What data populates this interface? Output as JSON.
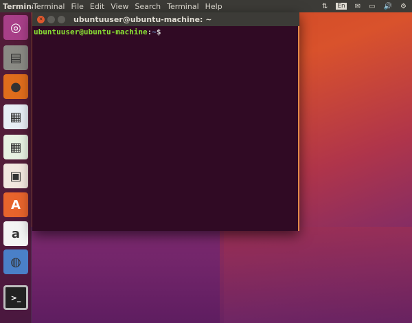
{
  "topbar": {
    "app_name": "Terminal",
    "menu": [
      "Terminal",
      "File",
      "Edit",
      "View",
      "Search",
      "Terminal",
      "Help"
    ],
    "tray": {
      "network_icon": "⇅",
      "keyboard": "En",
      "mail_icon": "✉",
      "battery_icon": "▭",
      "volume_icon": "🔊",
      "power_icon": "⚙"
    }
  },
  "launcher": {
    "items": [
      {
        "name": "ubuntu-dash",
        "glyph": "◎",
        "bg": "#a83f88"
      },
      {
        "name": "files",
        "glyph": "▤",
        "bg": "#8a8a84"
      },
      {
        "name": "firefox",
        "glyph": "●",
        "bg": "#e06d1c"
      },
      {
        "name": "libreoffice-writer",
        "glyph": "▦",
        "bg": "#e8eef5"
      },
      {
        "name": "libreoffice-calc",
        "glyph": "▦",
        "bg": "#e8f2e2"
      },
      {
        "name": "libreoffice-impress",
        "glyph": "▣",
        "bg": "#f3e8e0"
      },
      {
        "name": "software-center",
        "glyph": "A",
        "bg": "#e8642c"
      },
      {
        "name": "amazon",
        "glyph": "a",
        "bg": "#f4f4f4"
      },
      {
        "name": "stacked-apps",
        "glyph": "◍",
        "bg": "#4a80c8"
      },
      {
        "name": "terminal",
        "glyph": ">_",
        "bg": "#bdbdbd"
      }
    ]
  },
  "window": {
    "title": "ubuntuuser@ubuntu-machine: ~",
    "prompt": {
      "user": "ubuntuuser@ubuntu-machine",
      "colon": ":",
      "path": "~",
      "symbol": "$"
    }
  }
}
